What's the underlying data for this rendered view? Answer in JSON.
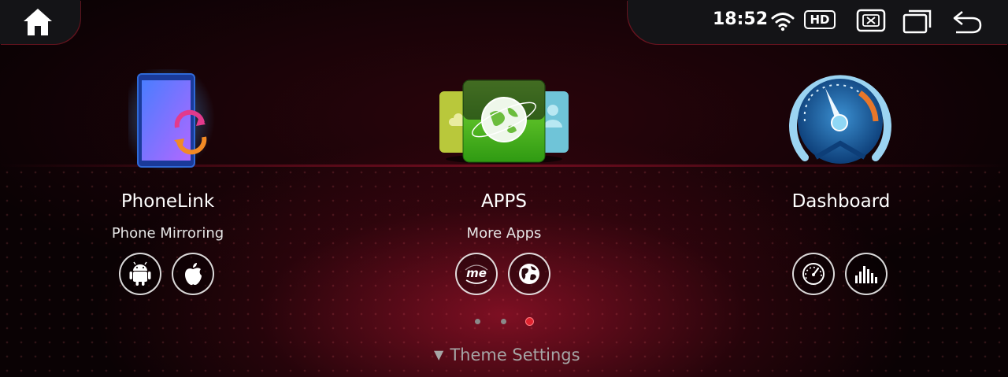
{
  "status_bar": {
    "time": "18:52",
    "hd_label": "HD",
    "icons": [
      "home-icon",
      "wifi-icon",
      "hd-icon",
      "close-app-icon",
      "recent-windows-icon",
      "back-icon"
    ]
  },
  "tiles": [
    {
      "title": "PhoneLink",
      "subtitle": "Phone Mirroring",
      "icon": "phone-link-icon",
      "buttons": [
        "android-icon",
        "apple-icon"
      ]
    },
    {
      "title": "APPS",
      "subtitle": "More Apps",
      "icon": "apps-stack-icon",
      "buttons": [
        "me-icon",
        "globe-icon"
      ]
    },
    {
      "title": "Dashboard",
      "subtitle": "",
      "icon": "speedometer-icon",
      "buttons": [
        "gauge-icon",
        "equalizer-icon"
      ]
    }
  ],
  "pager": {
    "total": 3,
    "active": 3
  },
  "footer": {
    "theme_label": "Theme Settings"
  },
  "colors": {
    "accent": "#e0222e",
    "bar_bg": "#141417"
  }
}
